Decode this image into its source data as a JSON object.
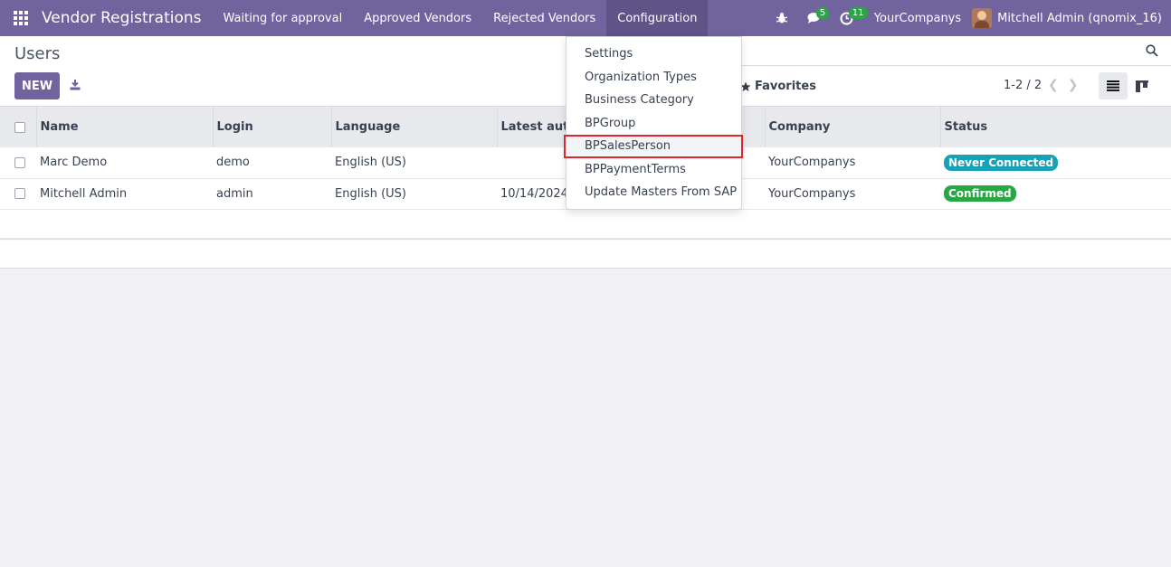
{
  "navbar": {
    "app_title": "Vendor Registrations",
    "menu": [
      {
        "label": "Waiting for approval"
      },
      {
        "label": "Approved Vendors"
      },
      {
        "label": "Rejected Vendors"
      },
      {
        "label": "Configuration"
      }
    ],
    "messages_count": "5",
    "activities_count": "11",
    "company": "YourCompanys",
    "user": "Mitchell Admin (qnomix_16)",
    "icons": [
      "apps-grid-icon",
      "bug-icon",
      "chat-icon",
      "clock-icon"
    ]
  },
  "control": {
    "breadcrumb": "Users",
    "new_label": "NEW",
    "search_hint": "..",
    "favorites_label": "Favorites",
    "pager": "1-2 / 2"
  },
  "dropdown": {
    "items": [
      {
        "label": "Settings"
      },
      {
        "label": "Organization Types"
      },
      {
        "label": "Business Category"
      },
      {
        "label": "BPGroup"
      },
      {
        "label": "BPSalesPerson"
      },
      {
        "label": "BPPaymentTerms"
      },
      {
        "label": "Update Masters From SAP"
      }
    ],
    "highlighted": "BPSalesPerson"
  },
  "table": {
    "columns": [
      "Name",
      "Login",
      "Language",
      "Latest authe",
      "Company",
      "Status"
    ],
    "rows": [
      {
        "name": "Marc Demo",
        "login": "demo",
        "language": "English (US)",
        "latest": "",
        "company": "YourCompanys",
        "status": "Never Connected"
      },
      {
        "name": "Mitchell Admin",
        "login": "admin",
        "language": "English (US)",
        "latest": "10/14/2024",
        "company": "YourCompanys",
        "status": "Confirmed"
      }
    ]
  },
  "colors": {
    "brand": "#71639e",
    "never_connected": "#17a2b8",
    "confirmed": "#28a745",
    "highlight_border": "#e0242e"
  }
}
